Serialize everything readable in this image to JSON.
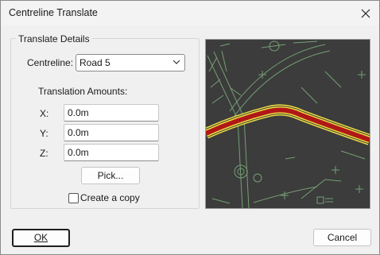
{
  "window": {
    "title": "Centreline Translate",
    "close_icon": "close-icon"
  },
  "group": {
    "label": "Translate Details"
  },
  "centreline": {
    "label": "Centreline:",
    "selected": "Road 5",
    "dropdown_icon": "chevron-down-icon"
  },
  "translation": {
    "heading": "Translation Amounts:",
    "x_label": "X:",
    "x_value": "0.0m",
    "y_label": "Y:",
    "y_value": "0.0m",
    "z_label": "Z:",
    "z_value": "0.0m"
  },
  "pick_button": "Pick...",
  "create_copy": {
    "label": "Create a copy",
    "checked": false
  },
  "ok_button": "OK",
  "cancel_button": "Cancel",
  "colors": {
    "preview_background": "#3c3c3c",
    "linework": "#7fb07f",
    "road_fill": "#b01818",
    "road_edge": "#f0e040"
  }
}
